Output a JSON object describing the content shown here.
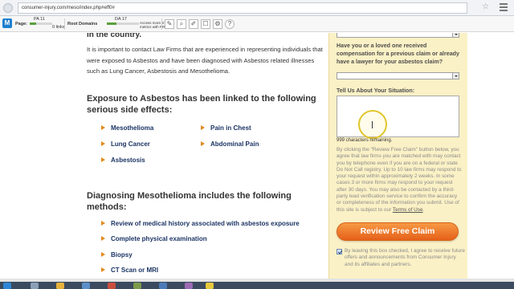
{
  "browser": {
    "url": "consumer-injury.com/meso/index.php#eff0#"
  },
  "seo_toolbar": {
    "page_label": "Page:",
    "page_value": "PA 11",
    "page_sub": "0 links",
    "root_domains_label": "Root Domains",
    "root_value": "DA 17",
    "access_note": "Access more link metrics with PRO"
  },
  "article": {
    "lead_heading": "in the country.",
    "intro": "It is important to contact Law Firms that are experienced in representing individuals that were exposed to Asbestos and have been diagnosed with Asbestos related illnesses such as Lung Cancer, Asbestosis and Mesothelioma.",
    "side_effects_heading": "Exposure to Asbestos has been linked to the following serious side effects:",
    "side_effects": [
      "Mesothelioma",
      "Lung Cancer",
      "Asbestosis",
      "Pain in Chest",
      "Abdominal Pain"
    ],
    "diagnosis_heading": "Diagnosing Mesothelioma includes the following methods:",
    "methods": [
      "Review of medical history associated with asbestos exposure",
      "Complete physical examination",
      "Biopsy",
      "CT Scan or MRI"
    ]
  },
  "form": {
    "previous_comp_question": "Have you or a loved one received compensation for a previous claim or already have a lawyer for your asbestos claim?",
    "situation_label": "Tell Us About Your Situation:",
    "chars_remaining": "999 characters remaining.",
    "legal_text": "By clicking the \"Review Free Claim\" button below, you agree that law firms you are matched with may contact you by telephone even if you are on a federal or state Do Not Call registry. Up to 10 law firms may respond to your request within approximately 2 weeks. In some cases 3 or more firms may respond to your request after 30 days. You may also be contacted by a third-party lead verification service to confirm the accuracy or completeness of the information you submit. Use of this site is subject to our",
    "terms_link": "Terms of Use",
    "terms_end": ".",
    "submit_label": "Review Free Claim",
    "optin_text": "By leaving this box checked, I agree to receive future offers and announcements from Consumer Injury and its affiliates and partners.",
    "colors": {
      "panel_bg": "#fbf1c6",
      "button": "#ef7a2c",
      "bullet_arrow": "#e08a1e",
      "link_text": "#1b3464"
    }
  },
  "icons": [
    "back-icon",
    "star-icon",
    "menu-icon",
    "seo-logo-icon",
    "highlight-icon",
    "search-icon",
    "edit-icon",
    "check-icon",
    "settings-icon",
    "help-icon"
  ]
}
